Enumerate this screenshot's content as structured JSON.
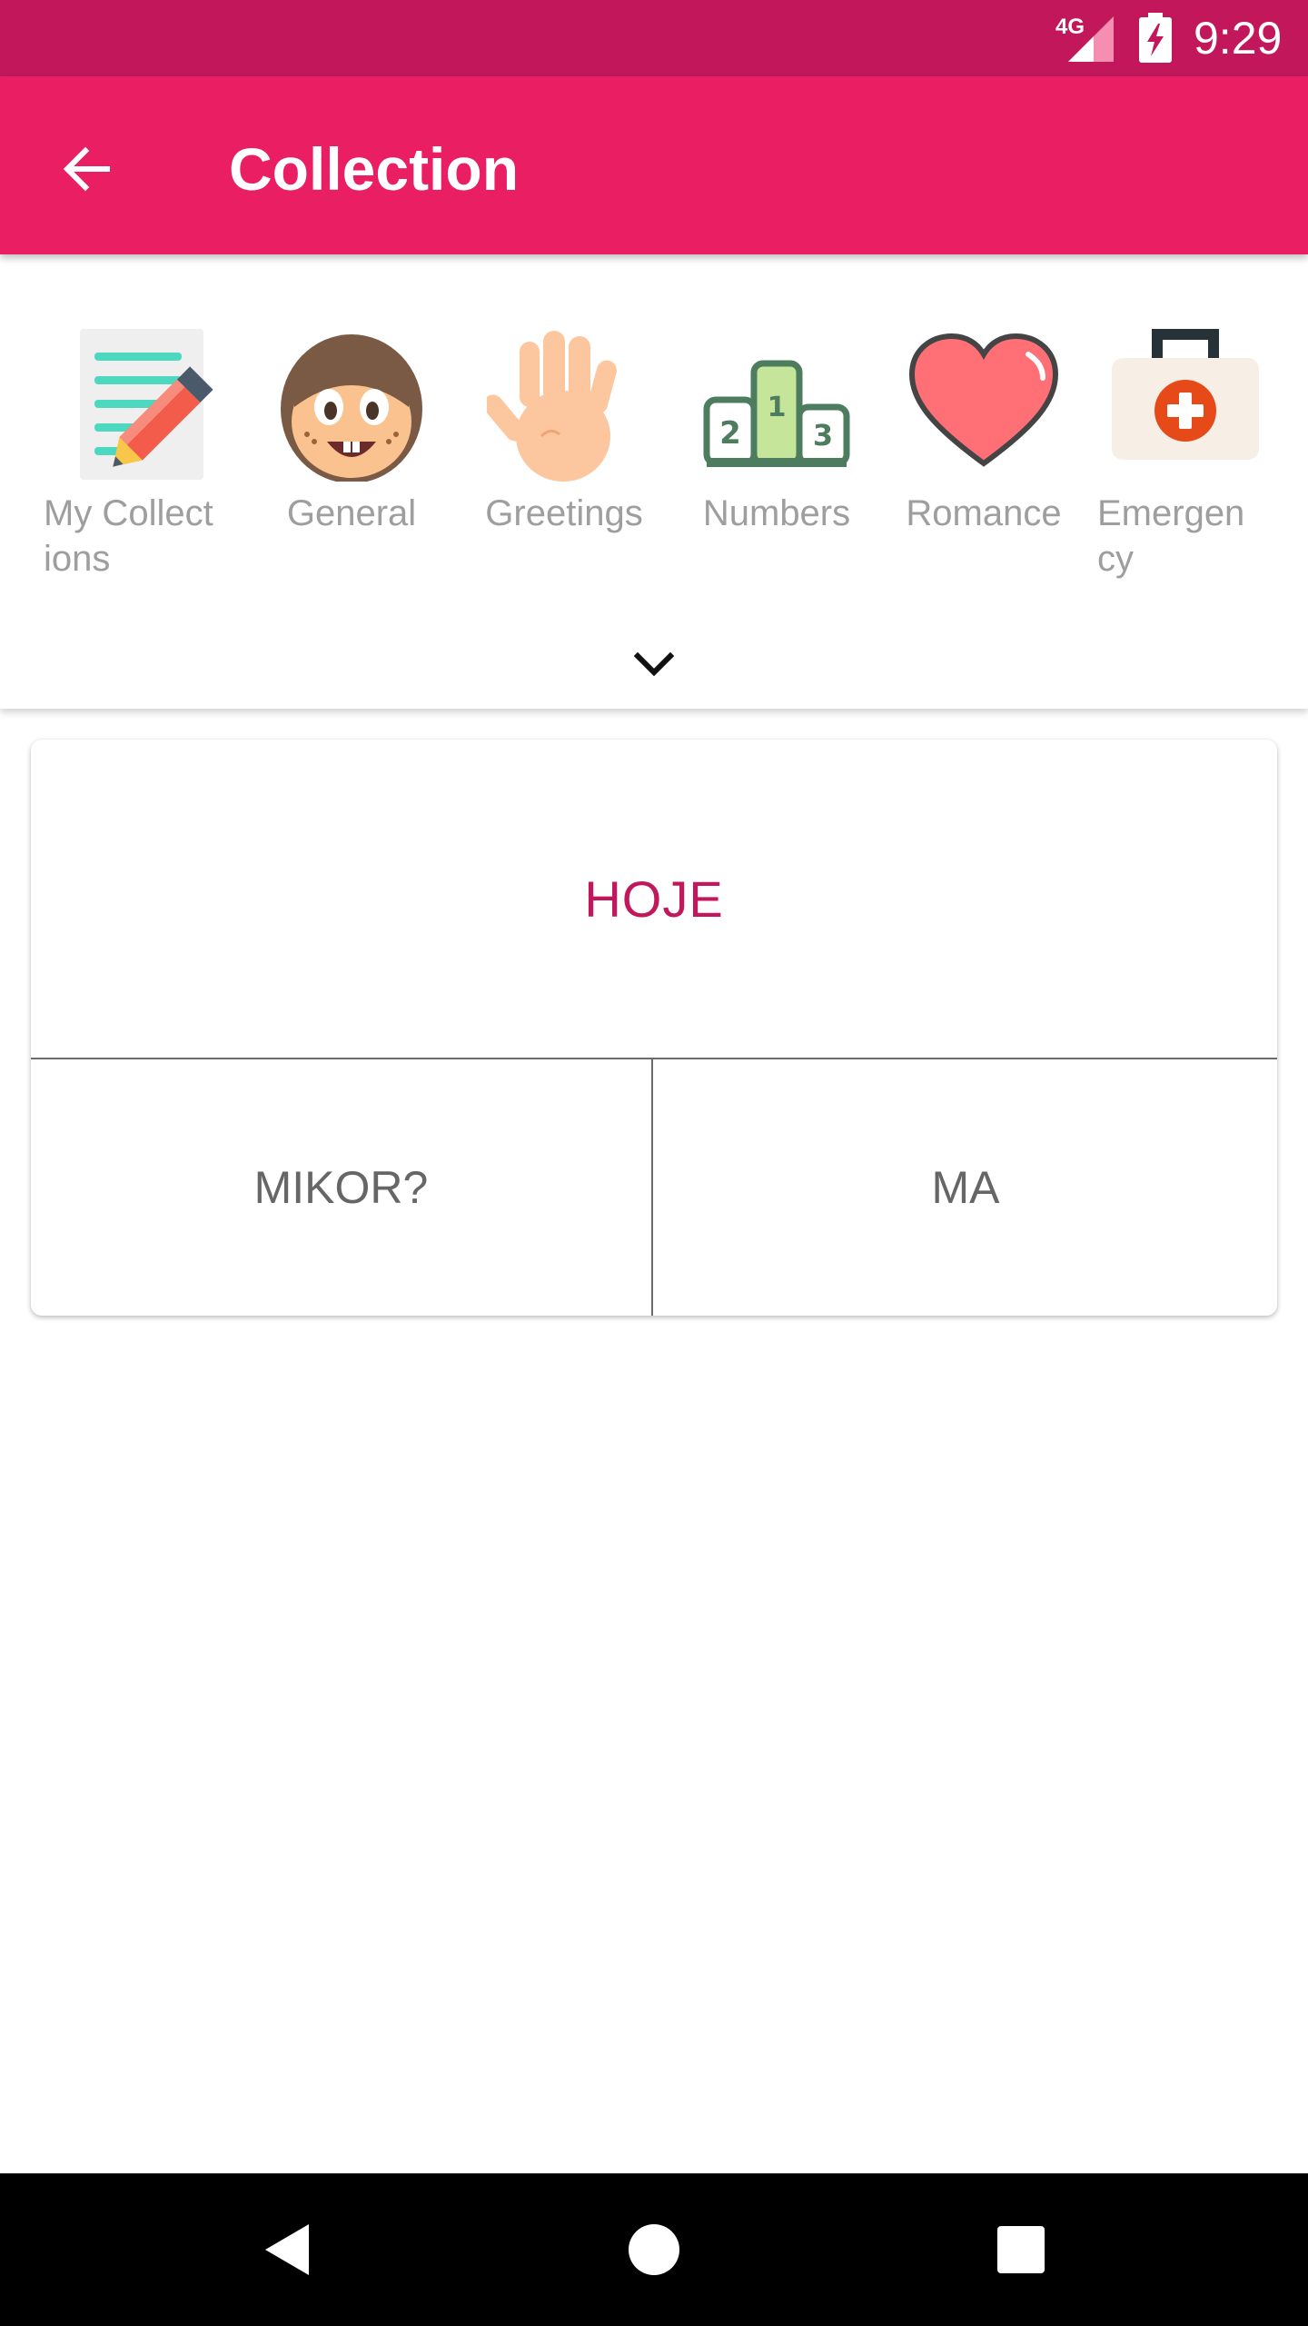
{
  "status_bar": {
    "network": "4G",
    "time": "9:29",
    "icons": [
      "signal-icon",
      "battery-charging-icon"
    ]
  },
  "app_bar": {
    "title": "Collection",
    "back_icon": "arrow-left-icon"
  },
  "categories": {
    "items": [
      {
        "label": "My Collect\nions",
        "icon": "notepad-pencil-icon"
      },
      {
        "label": "General",
        "icon": "face-icon"
      },
      {
        "label": "Greetings",
        "icon": "hand-icon"
      },
      {
        "label": "Numbers",
        "icon": "podium-icon"
      },
      {
        "label": "Romance",
        "icon": "heart-icon"
      },
      {
        "label": "Emergen\ncy",
        "icon": "first-aid-kit-icon"
      }
    ],
    "expand_icon": "chevron-down-icon"
  },
  "card": {
    "main_word": "HOJE",
    "options": [
      "MIKOR?",
      "MA"
    ]
  },
  "nav_bar": {
    "icons": [
      "back-triangle-icon",
      "home-circle-icon",
      "recents-square-icon"
    ]
  },
  "colors": {
    "status_bar": "#C2185B",
    "app_bar": "#E91E63",
    "accent_text": "#C2185B"
  }
}
